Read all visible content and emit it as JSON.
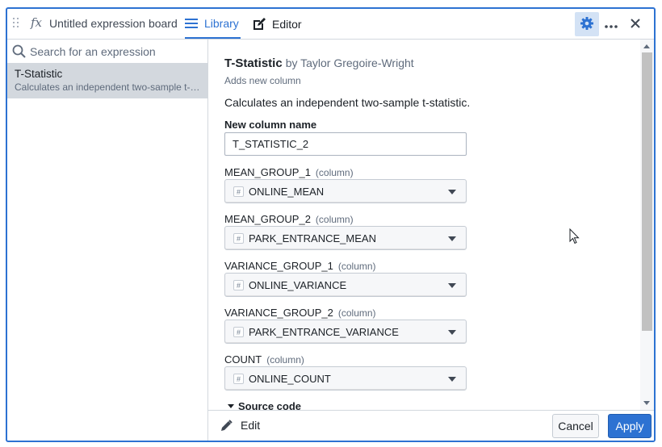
{
  "header": {
    "fx_symbol": "fx",
    "board_title": "Untitled expression board",
    "tabs": [
      {
        "label": "Library",
        "icon": "list-icon",
        "active": true
      },
      {
        "label": "Editor",
        "icon": "edit-icon",
        "active": false
      }
    ],
    "actions": [
      "gear-icon",
      "more-icon",
      "close-icon"
    ]
  },
  "sidebar": {
    "search_placeholder": "Search for an expression",
    "items": [
      {
        "title": "T-Statistic",
        "description": "Calculates an independent two-sample t-statistic."
      }
    ]
  },
  "expression": {
    "name": "T-Statistic",
    "author": "by Taylor Gregoire-Wright",
    "badge": "Adds new column",
    "description": "Calculates an independent two-sample t-statistic.",
    "new_column_label": "New column name",
    "new_column_value": "T_STATISTIC_2",
    "column_hint": "(column)",
    "params": [
      {
        "name": "MEAN_GROUP_1",
        "value": "ONLINE_MEAN"
      },
      {
        "name": "MEAN_GROUP_2",
        "value": "PARK_ENTRANCE_MEAN"
      },
      {
        "name": "VARIANCE_GROUP_1",
        "value": "ONLINE_VARIANCE"
      },
      {
        "name": "VARIANCE_GROUP_2",
        "value": "PARK_ENTRANCE_VARIANCE"
      },
      {
        "name": "COUNT",
        "value": "ONLINE_COUNT"
      }
    ],
    "type_symbol": "#",
    "source_code_label": "Source code"
  },
  "footer": {
    "edit_label": "Edit",
    "cancel_label": "Cancel",
    "apply_label": "Apply"
  },
  "colors": {
    "accent": "#2d72d2",
    "selected_bg": "#d3d8de"
  }
}
